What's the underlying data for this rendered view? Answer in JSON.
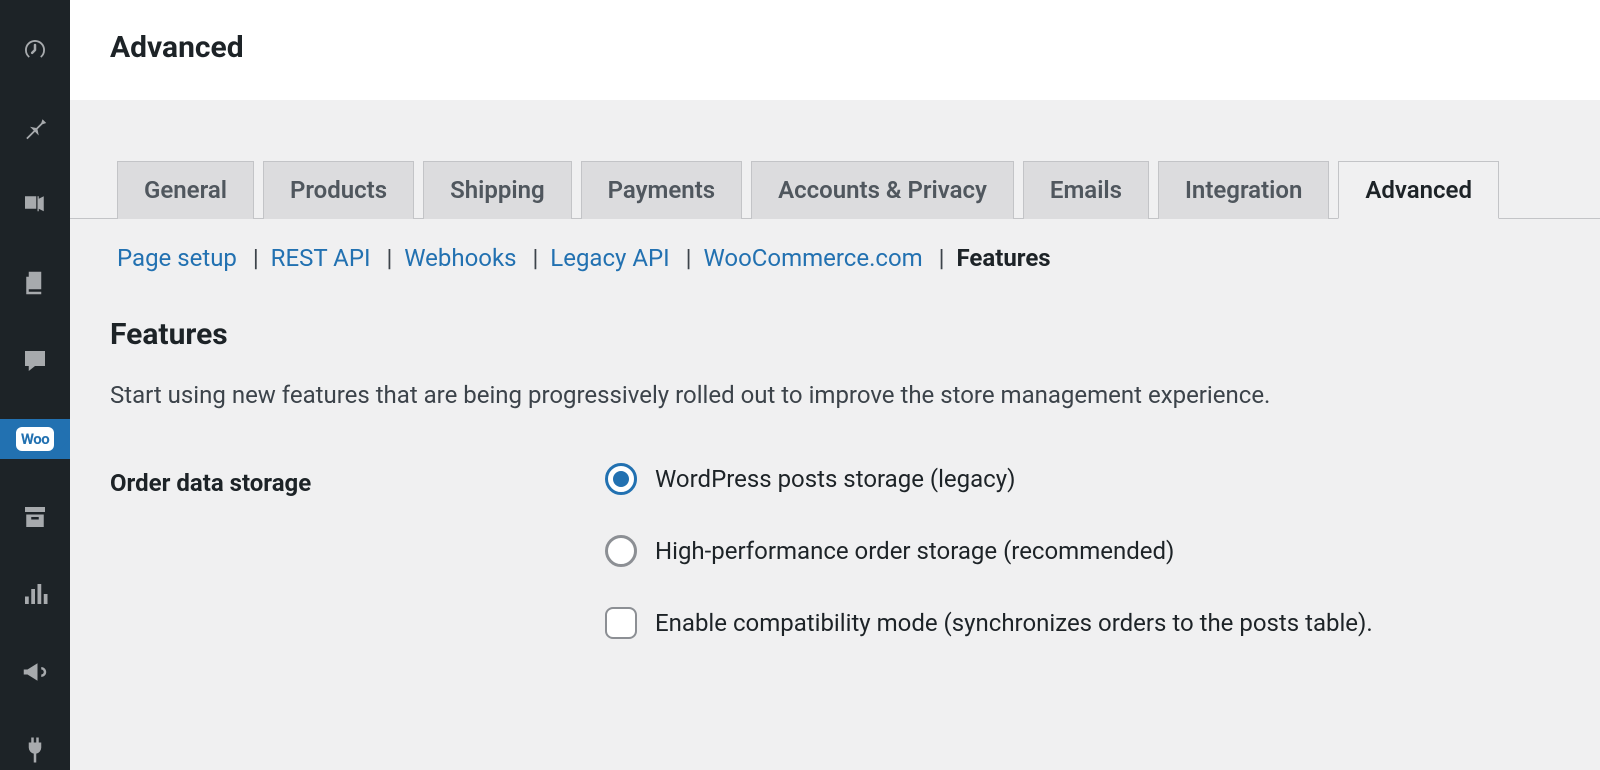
{
  "header": {
    "title": "Advanced"
  },
  "sidebar": {
    "items": [
      {
        "name": "dashboard",
        "icon": "gauge"
      },
      {
        "name": "posts",
        "icon": "pin"
      },
      {
        "name": "media",
        "icon": "media"
      },
      {
        "name": "pages",
        "icon": "pages"
      },
      {
        "name": "comments",
        "icon": "comment"
      },
      {
        "name": "woocommerce",
        "icon": "woo",
        "active": true,
        "label": "Woo"
      },
      {
        "name": "products",
        "icon": "archive"
      },
      {
        "name": "analytics",
        "icon": "bars"
      },
      {
        "name": "marketing",
        "icon": "megaphone"
      },
      {
        "name": "plugins",
        "icon": "plug"
      }
    ]
  },
  "tabs": [
    {
      "label": "General"
    },
    {
      "label": "Products"
    },
    {
      "label": "Shipping"
    },
    {
      "label": "Payments"
    },
    {
      "label": "Accounts & Privacy"
    },
    {
      "label": "Emails"
    },
    {
      "label": "Integration"
    },
    {
      "label": "Advanced",
      "active": true
    }
  ],
  "subnav": {
    "items": [
      {
        "label": "Page setup"
      },
      {
        "label": "REST API"
      },
      {
        "label": "Webhooks"
      },
      {
        "label": "Legacy API"
      },
      {
        "label": "WooCommerce.com"
      },
      {
        "label": "Features",
        "current": true
      }
    ]
  },
  "section": {
    "title": "Features",
    "description": "Start using new features that are being progressively rolled out to improve the store management experience.",
    "field_label": "Order data storage",
    "options": [
      {
        "label": "WordPress posts storage (legacy)",
        "type": "radio",
        "checked": true
      },
      {
        "label": "High-performance order storage (recommended)",
        "type": "radio",
        "checked": false
      },
      {
        "label": "Enable compatibility mode (synchronizes orders to the posts table).",
        "type": "checkbox",
        "checked": false
      }
    ]
  }
}
